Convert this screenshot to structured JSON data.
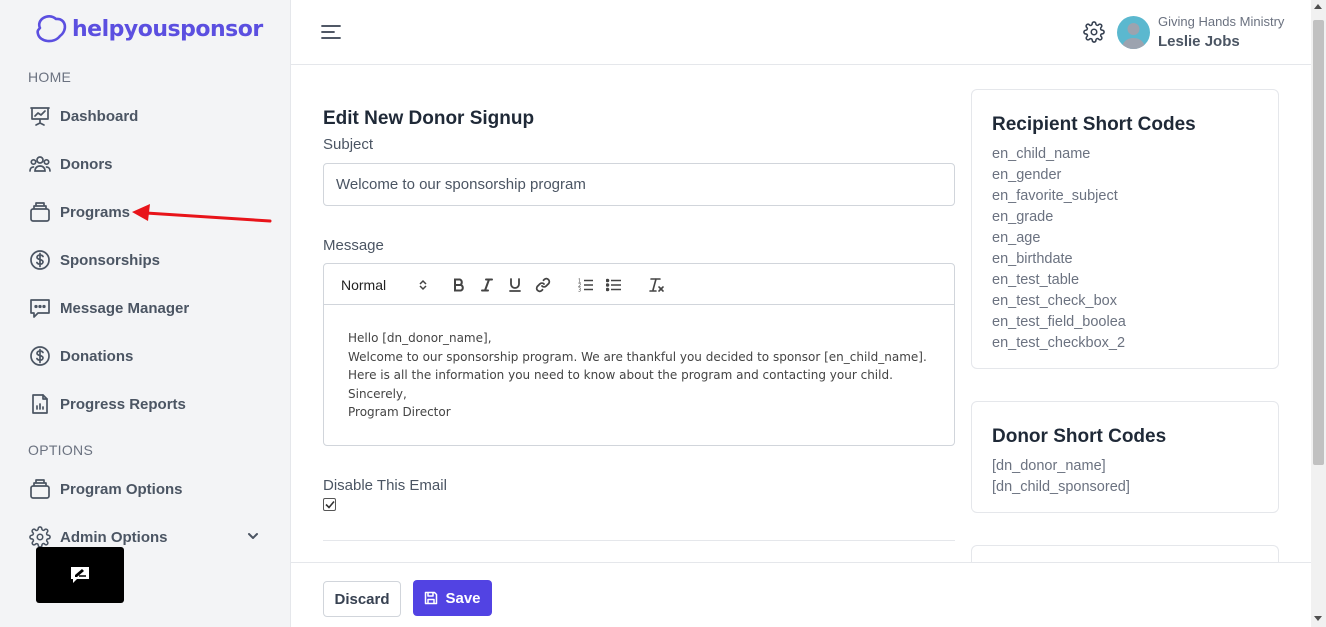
{
  "app": {
    "logo_text": "helpyousponsor"
  },
  "sidebar": {
    "home_label": "HOME",
    "options_label": "OPTIONS",
    "items": [
      {
        "label": "Dashboard",
        "icon": "presentation-chart-icon"
      },
      {
        "label": "Donors",
        "icon": "users-group-icon"
      },
      {
        "label": "Programs",
        "icon": "briefcase-icon"
      },
      {
        "label": "Sponsorships",
        "icon": "dollar-circle-icon"
      },
      {
        "label": "Message Manager",
        "icon": "chat-bubble-icon"
      },
      {
        "label": "Donations",
        "icon": "dollar-circle-icon"
      },
      {
        "label": "Progress Reports",
        "icon": "document-chart-icon"
      }
    ],
    "option_items": [
      {
        "label": "Program Options",
        "icon": "briefcase-icon"
      },
      {
        "label": "Admin Options",
        "icon": "gear-icon"
      }
    ]
  },
  "header": {
    "org_name": "Giving Hands Ministry",
    "user_name": "Leslie Jobs"
  },
  "form": {
    "title": "Edit New Donor Signup",
    "subject_label": "Subject",
    "subject_value": "Welcome to our sponsorship program",
    "message_label": "Message",
    "toolbar_format": "Normal",
    "message_lines": [
      "Hello [dn_donor_name],",
      "Welcome to our sponsorship program. We are thankful you decided to sponsor [en_child_name].",
      "Here is all the information you need to know about the program and contacting your child.",
      "Sincerely,",
      "Program Director"
    ],
    "disable_label": "Disable This Email",
    "disable_checked": true
  },
  "recipient_codes": {
    "title": "Recipient Short Codes",
    "items": [
      "en_child_name",
      "en_gender",
      "en_favorite_subject",
      "en_grade",
      "en_age",
      "en_birthdate",
      "en_test_table",
      "en_test_check_box",
      "en_test_field_boolea",
      "en_test_checkbox_2"
    ]
  },
  "donor_codes": {
    "title": "Donor Short Codes",
    "items": [
      "[dn_donor_name]",
      "[dn_child_sponsored]"
    ]
  },
  "actions": {
    "discard_label": "Discard",
    "save_label": "Save"
  },
  "colors": {
    "accent": "#5243e3",
    "sidebar_bg": "#f3f4f6",
    "annotation_arrow": "#e8141a"
  }
}
